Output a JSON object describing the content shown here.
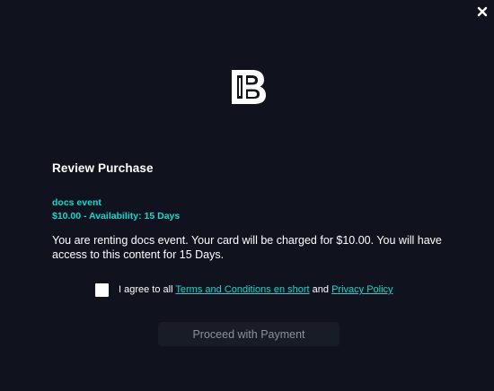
{
  "modal": {
    "close_icon": "close-icon",
    "logo_icon": "brand-b-logo"
  },
  "purchase": {
    "title": "Review Purchase",
    "event_name": "docs event",
    "price_availability": "$10.00 - Availability: 15 Days",
    "description": "You are renting docs event. Your card will be charged for $10.00. You will have access to this content for 15 Days."
  },
  "agreement": {
    "checked": false,
    "prefix": "I agree to all",
    "terms_link": "Terms and Conditions en short",
    "conjunction": "and",
    "privacy_link": "Privacy Policy"
  },
  "actions": {
    "proceed_label": "Proceed with Payment"
  },
  "colors": {
    "background": "#10131d",
    "accent": "#17d7cf",
    "button_bg": "#181c26",
    "button_text": "#8b909b"
  }
}
